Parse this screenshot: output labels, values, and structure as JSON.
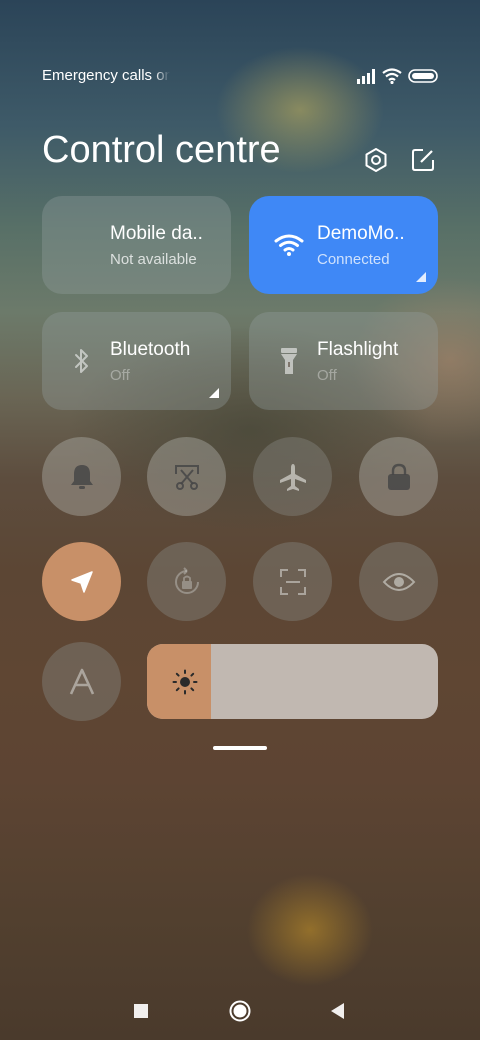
{
  "status_bar": {
    "text": "Emergency calls only",
    "icons": [
      "signal-icon",
      "wifi-icon",
      "battery-icon"
    ]
  },
  "header": {
    "title": "Control centre",
    "actions": [
      "settings-icon",
      "edit-icon"
    ]
  },
  "tiles": [
    {
      "label": "Mobile da..",
      "status": "Not available",
      "icon": "mobile-data-icon",
      "active": false
    },
    {
      "label": "DemoMo..",
      "status": "Connected",
      "icon": "wifi-icon",
      "active": true
    },
    {
      "label": "Bluetooth",
      "status": "Off",
      "icon": "bluetooth-icon",
      "active": false
    },
    {
      "label": "Flashlight",
      "status": "Off",
      "icon": "flashlight-icon",
      "active": false
    }
  ],
  "toggles": [
    {
      "icon": "bell-icon",
      "active": true
    },
    {
      "icon": "screenshot-icon",
      "active": true
    },
    {
      "icon": "airplane-icon",
      "active": false
    },
    {
      "icon": "lock-icon",
      "active": true
    },
    {
      "icon": "location-icon",
      "active": true
    },
    {
      "icon": "rotation-lock-icon",
      "active": false
    },
    {
      "icon": "scanner-icon",
      "active": false
    },
    {
      "icon": "eye-icon",
      "active": false
    },
    {
      "icon": "auto-brightness-icon",
      "active": false
    }
  ],
  "brightness": {
    "level": 0.22,
    "icon": "sun-icon"
  },
  "colors": {
    "accent": "#c89068",
    "wifi_active": "#3f88f6"
  },
  "nav_bar": {
    "buttons": [
      "recents-icon",
      "home-icon",
      "back-icon"
    ]
  }
}
